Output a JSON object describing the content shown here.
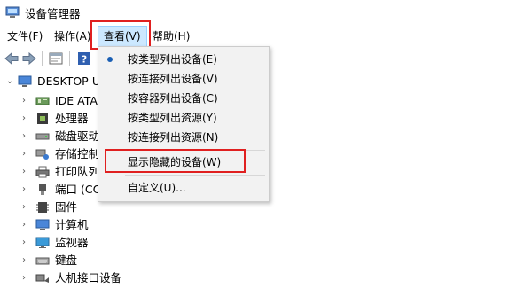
{
  "window": {
    "title": "设备管理器"
  },
  "menubar": {
    "items": [
      {
        "label": "文件(F)"
      },
      {
        "label": "操作(A)"
      },
      {
        "label": "查看(V)"
      },
      {
        "label": "帮助(H)"
      }
    ]
  },
  "view_menu": {
    "items": [
      {
        "label": "按类型列出设备(E)",
        "checked": true
      },
      {
        "label": "按连接列出设备(V)"
      },
      {
        "label": "按容器列出设备(C)"
      },
      {
        "label": "按类型列出资源(Y)"
      },
      {
        "label": "按连接列出资源(N)"
      },
      {
        "label": "显示隐藏的设备(W)"
      },
      {
        "label": "自定义(U)..."
      }
    ]
  },
  "tree": {
    "root": "DESKTOP-U",
    "categories": [
      {
        "label": "IDE ATA/",
        "icon": "ide-controller-icon"
      },
      {
        "label": "处理器",
        "icon": "processor-icon"
      },
      {
        "label": "磁盘驱动",
        "icon": "disk-drive-icon"
      },
      {
        "label": "存储控制",
        "icon": "storage-controller-icon"
      },
      {
        "label": "打印队列",
        "icon": "printer-icon"
      },
      {
        "label": "端口 (CO",
        "icon": "port-icon"
      },
      {
        "label": "固件",
        "icon": "firmware-icon"
      },
      {
        "label": "计算机",
        "icon": "computer-icon"
      },
      {
        "label": "监视器",
        "icon": "monitor-icon"
      },
      {
        "label": "键盘",
        "icon": "keyboard-icon"
      },
      {
        "label": "人机接口设备",
        "icon": "hid-icon"
      }
    ]
  },
  "colors": {
    "highlight": "#e02020",
    "menu_active": "#cce8ff",
    "accent": "#1a5fb4"
  }
}
